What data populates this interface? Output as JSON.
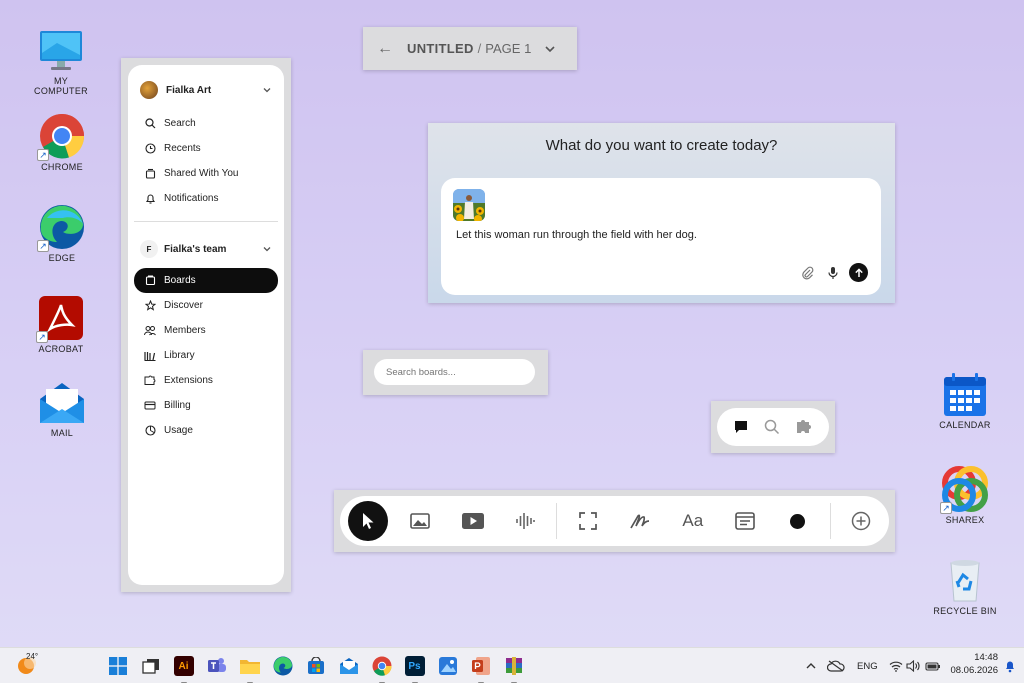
{
  "desktop": {
    "icons": [
      {
        "label": "MY COMPUTER",
        "icon": "monitor-icon"
      },
      {
        "label": "CHROME",
        "icon": "chrome-icon"
      },
      {
        "label": "EDGE",
        "icon": "edge-icon"
      },
      {
        "label": "ACROBAT",
        "icon": "acrobat-icon"
      },
      {
        "label": "MAIL",
        "icon": "mail-icon"
      },
      {
        "label": "CALENDAR",
        "icon": "calendar-icon"
      },
      {
        "label": "SHAREX",
        "icon": "sharex-icon"
      },
      {
        "label": "RECYCLE BIN",
        "icon": "recycle-bin-icon"
      }
    ]
  },
  "titlebar": {
    "back_icon": "arrow-left-icon",
    "title": "UNTITLED",
    "separator": "/",
    "page": "PAGE 1",
    "menu_icon": "chevron-down-icon"
  },
  "sidebar": {
    "workspace": {
      "name": "Fialka Art",
      "icon": "avatar"
    },
    "top_items": [
      {
        "label": "Search",
        "icon": "search-icon"
      },
      {
        "label": "Recents",
        "icon": "clock-icon"
      },
      {
        "label": "Shared With You",
        "icon": "shared-icon"
      },
      {
        "label": "Notifications",
        "icon": "bell-icon"
      }
    ],
    "team": {
      "initial": "F",
      "name": "Fialka's team"
    },
    "team_items": [
      {
        "label": "Boards",
        "icon": "boards-icon",
        "active": true
      },
      {
        "label": "Discover",
        "icon": "star-icon"
      },
      {
        "label": "Members",
        "icon": "members-icon"
      },
      {
        "label": "Library",
        "icon": "library-icon"
      },
      {
        "label": "Extensions",
        "icon": "extensions-icon"
      },
      {
        "label": "Billing",
        "icon": "billing-icon"
      },
      {
        "label": "Usage",
        "icon": "usage-icon"
      }
    ]
  },
  "prompt": {
    "heading": "What do you want to create today?",
    "text": "Let this woman run through the field with her dog.",
    "attach_icon": "paperclip-icon",
    "mic_icon": "microphone-icon",
    "send_icon": "arrow-up-icon"
  },
  "search_boards": {
    "placeholder": "Search boards..."
  },
  "mini_toolbar": [
    "comment-icon",
    "search-icon",
    "puzzle-icon"
  ],
  "toolbar": {
    "text_tool_label": "Aa",
    "tools": [
      "cursor-icon",
      "image-icon",
      "video-icon",
      "audio-icon",
      "frame-icon",
      "pen-icon",
      "text-icon",
      "note-icon",
      "color-icon",
      "add-icon"
    ]
  },
  "taskbar": {
    "weather_temp": "24°",
    "language": "ENG",
    "time": "14:48",
    "date": "08.06.2026"
  },
  "colors": {
    "desktop_bg": "#d4caf3",
    "active_item": "#0d0d0d",
    "panel_frame": "#dcdcde"
  }
}
